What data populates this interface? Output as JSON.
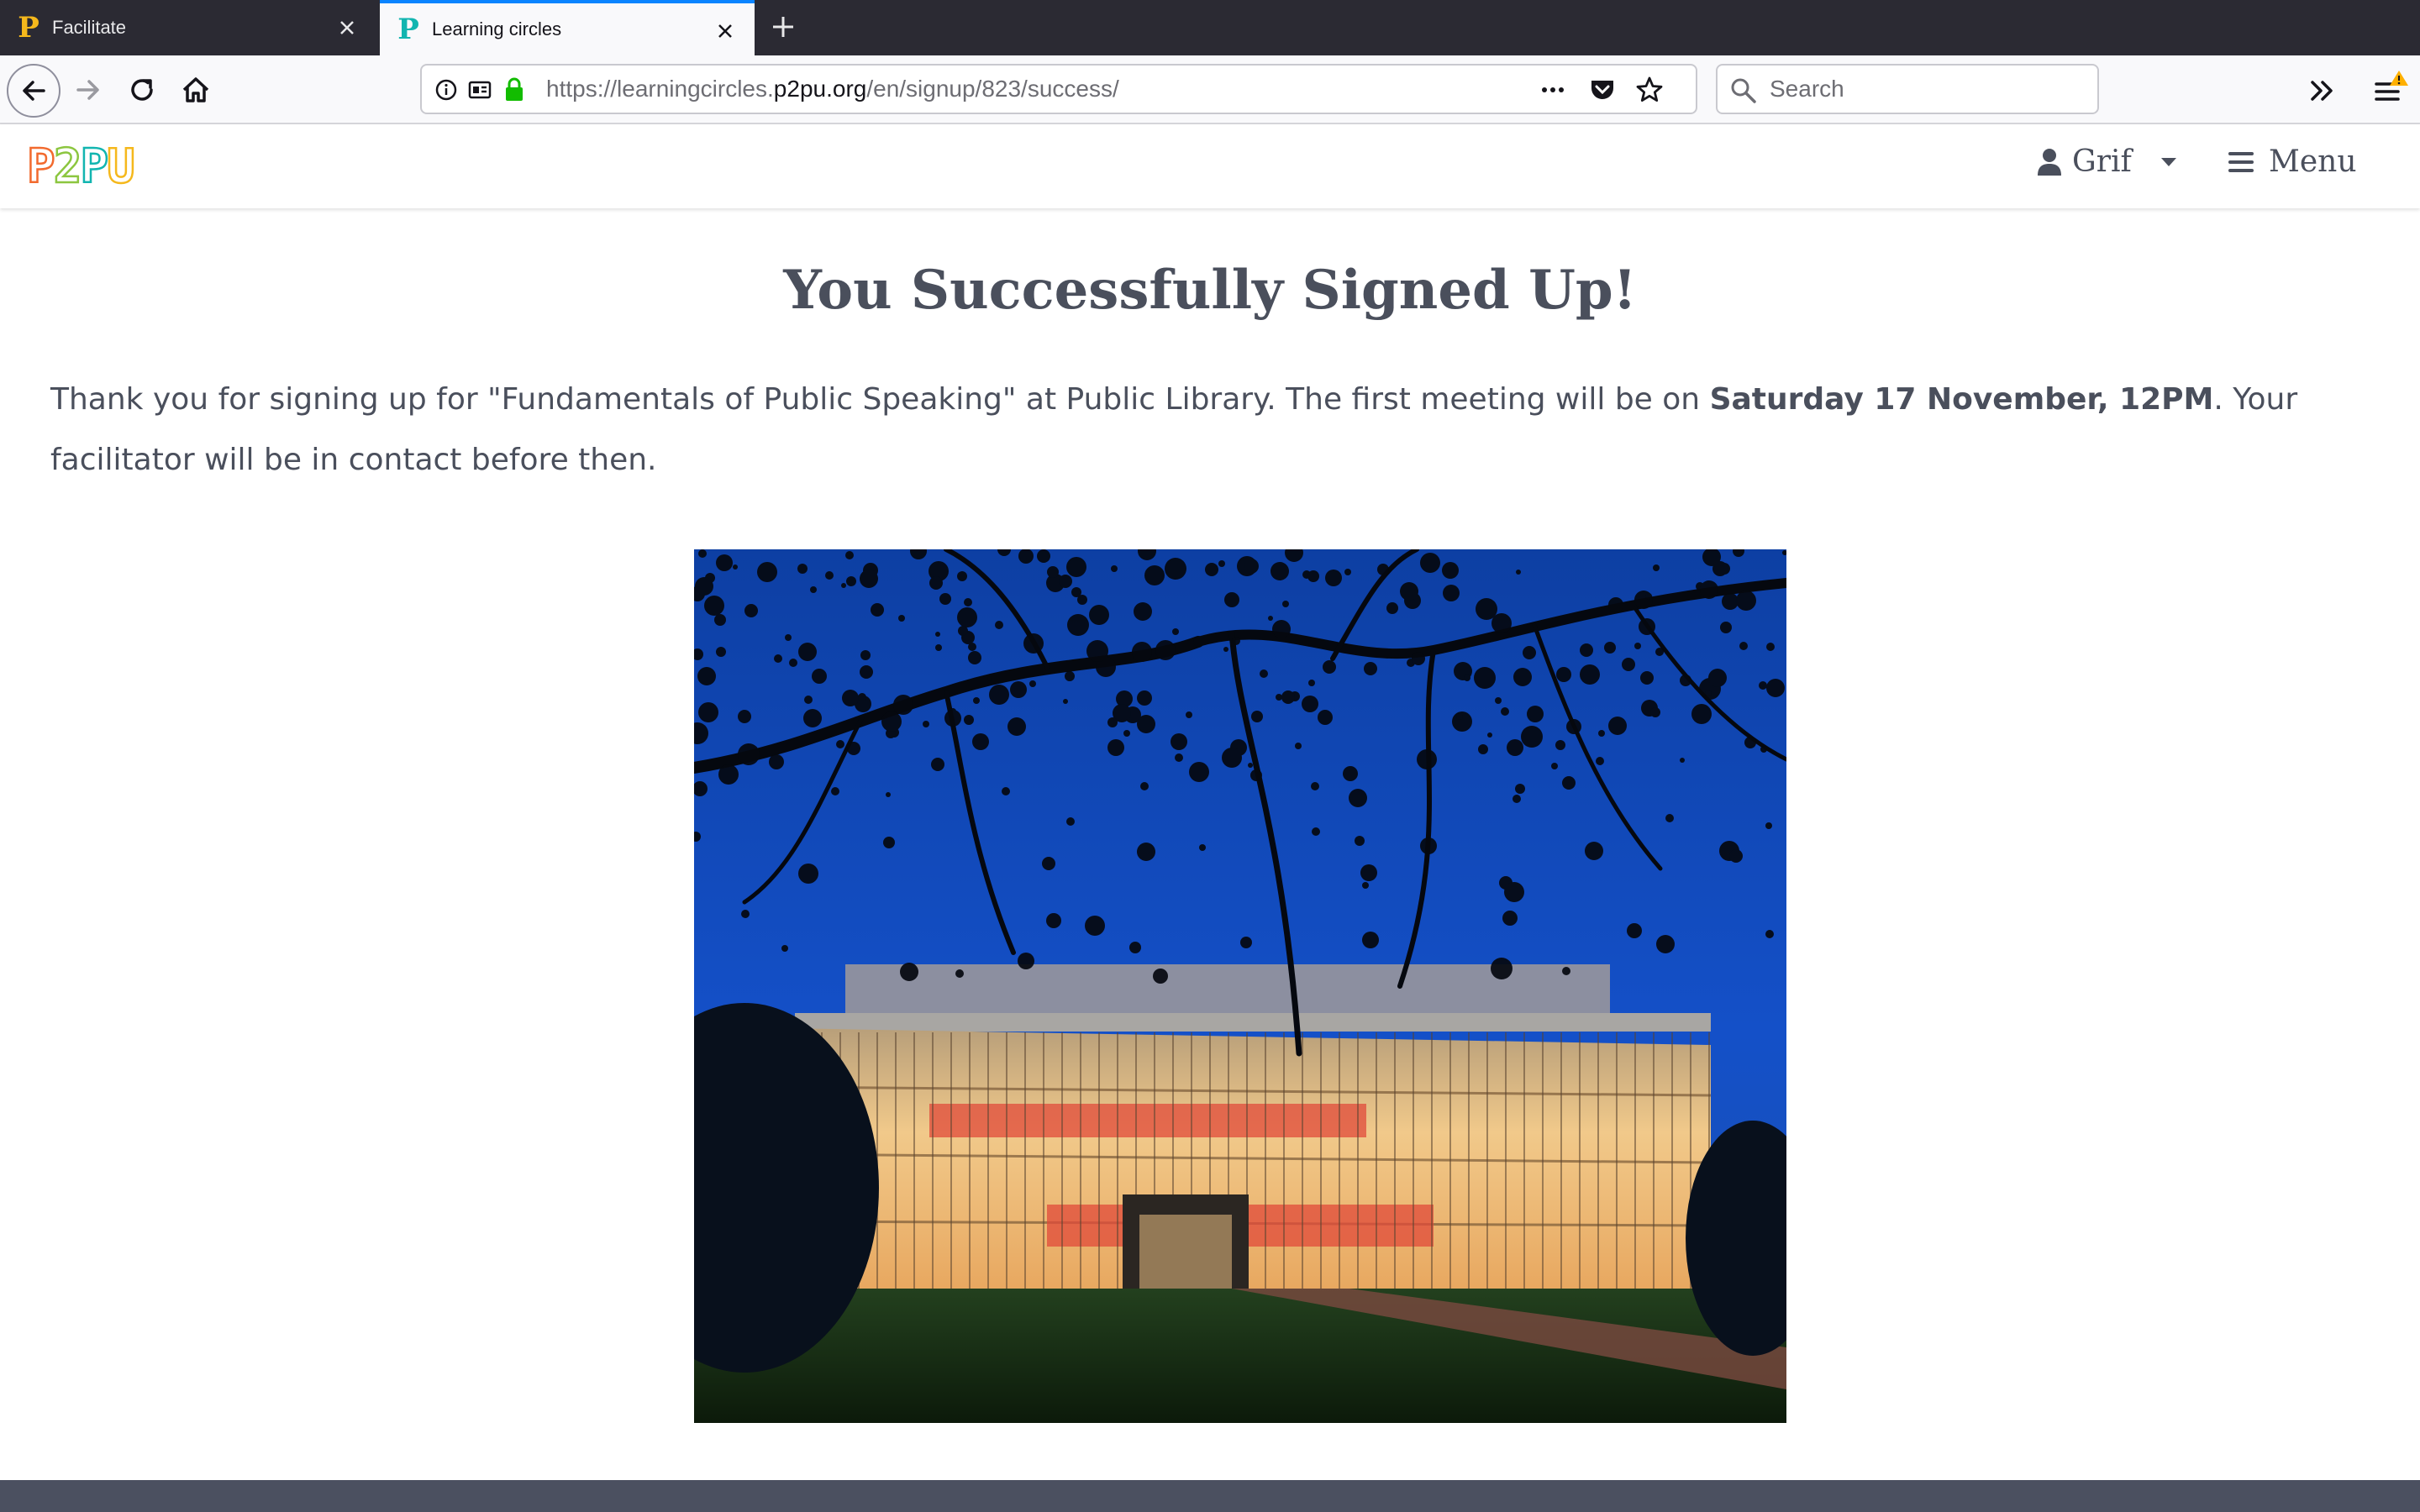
{
  "browser": {
    "tabs": [
      {
        "title": "Facilitate",
        "favicon": "p2pu-favicon-yellow",
        "active": false
      },
      {
        "title": "Learning circles",
        "favicon": "p2pu-favicon-teal",
        "active": true
      }
    ],
    "url": {
      "prefix": "https://learningcircles.",
      "host": "p2pu.org",
      "path": "/en/signup/823/success/"
    },
    "search_placeholder": "Search",
    "accent_color": "#0a84ff"
  },
  "site": {
    "logo": [
      "P",
      "2",
      "P",
      "U"
    ],
    "logo_colors": [
      "#f26a2e",
      "#8cc63f",
      "#12b5b0",
      "#f5b81c"
    ],
    "user_name": "Grif",
    "menu_label": "Menu"
  },
  "main": {
    "heading": "You Successfully Signed Up!",
    "message_before": "Thank you for signing up for \"Fundamentals of Public Speaking\" at Public Library. The first meeting will be on ",
    "message_date": "Saturday 17 November, 12PM",
    "message_after": ". Your facilitator will be in contact before then.",
    "image": "library-building-at-dusk"
  },
  "colors": {
    "text": "#4a4f5c",
    "footer": "#4b5060"
  }
}
